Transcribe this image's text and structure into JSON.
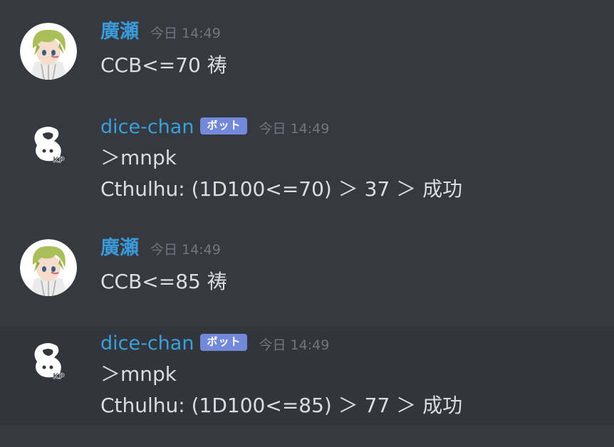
{
  "messages": [
    {
      "author": "廣瀬",
      "time": "今日 14:49",
      "lines": [
        "CCB<=70 祷"
      ]
    },
    {
      "author": "dice-chan",
      "badge": "ボット",
      "time": "今日 14:49",
      "lines": [
        "＞mnpk",
        "Cthulhu: (1D100<=70) ＞ 37 ＞ 成功"
      ]
    },
    {
      "author": "廣瀬",
      "time": "今日 14:49",
      "lines": [
        "CCB<=85 祷"
      ]
    },
    {
      "author": "dice-chan",
      "badge": "ボット",
      "time": "今日 14:49",
      "lines": [
        "＞mnpk",
        "Cthulhu: (1D100<=85) ＞ 77 ＞ 成功"
      ]
    }
  ],
  "colors": {
    "background": "#36393f",
    "username": "#3a9ad9",
    "bot_badge": "#7289da",
    "timestamp": "#72767d",
    "message_text": "#dcddde"
  },
  "icons": {
    "user_avatar": "anime-character-avatar",
    "bot_avatar": "dice-chan-logo"
  }
}
